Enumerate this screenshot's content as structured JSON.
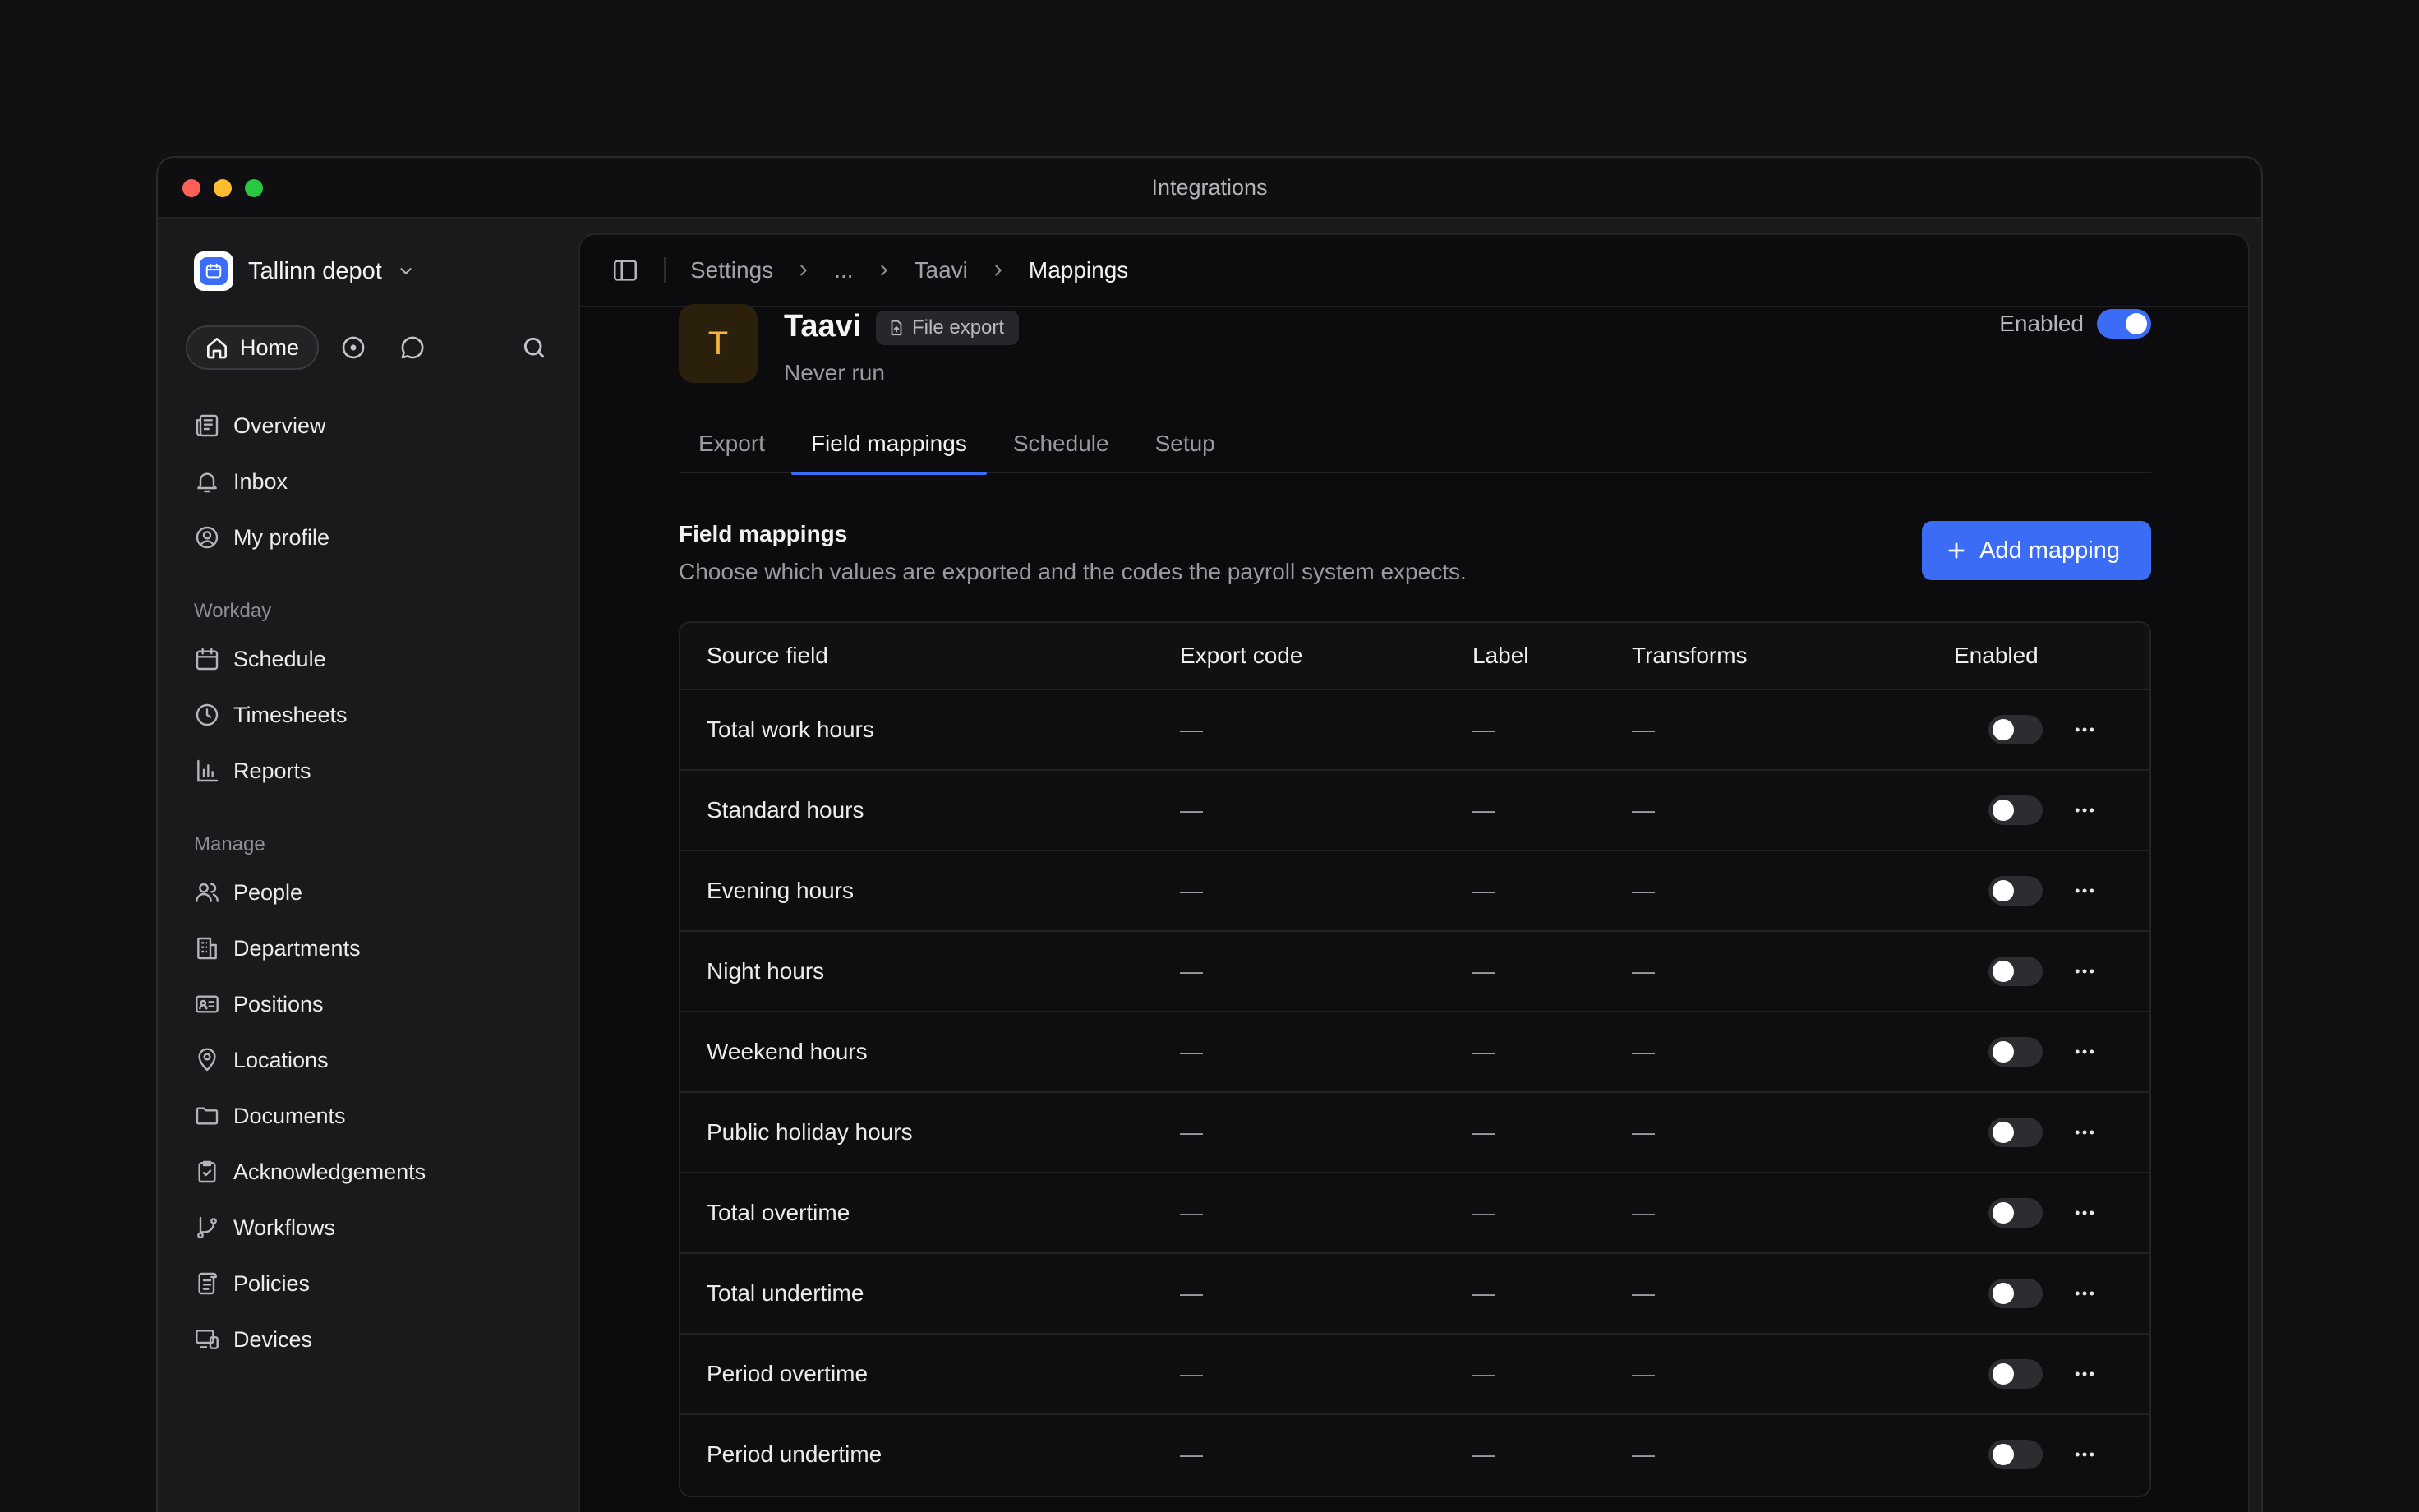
{
  "window": {
    "title": "Integrations"
  },
  "sidebar": {
    "workspace": "Tallinn depot",
    "home_label": "Home",
    "primary": [
      {
        "label": "Overview",
        "icon": "newspaper-icon"
      },
      {
        "label": "Inbox",
        "icon": "bell-icon"
      },
      {
        "label": "My profile",
        "icon": "user-circle-icon"
      }
    ],
    "sections": [
      {
        "title": "Workday",
        "items": [
          {
            "label": "Schedule",
            "icon": "calendar-icon"
          },
          {
            "label": "Timesheets",
            "icon": "clock-icon"
          },
          {
            "label": "Reports",
            "icon": "bar-chart-icon"
          }
        ]
      },
      {
        "title": "Manage",
        "items": [
          {
            "label": "People",
            "icon": "users-icon"
          },
          {
            "label": "Departments",
            "icon": "building-icon"
          },
          {
            "label": "Positions",
            "icon": "id-card-icon"
          },
          {
            "label": "Locations",
            "icon": "map-pin-icon"
          },
          {
            "label": "Documents",
            "icon": "folder-icon"
          },
          {
            "label": "Acknowledgements",
            "icon": "clipboard-check-icon"
          },
          {
            "label": "Workflows",
            "icon": "git-branch-icon"
          },
          {
            "label": "Policies",
            "icon": "scroll-icon"
          },
          {
            "label": "Devices",
            "icon": "devices-icon"
          }
        ]
      }
    ]
  },
  "breadcrumb": [
    "Settings",
    "...",
    "Taavi",
    "Mappings"
  ],
  "integration": {
    "avatar_letter": "T",
    "name": "Taavi",
    "badge": "File export",
    "status": "Never run",
    "enabled_label": "Enabled",
    "enabled": true
  },
  "tabs": [
    {
      "label": "Export",
      "active": false
    },
    {
      "label": "Field mappings",
      "active": true
    },
    {
      "label": "Schedule",
      "active": false
    },
    {
      "label": "Setup",
      "active": false
    }
  ],
  "section": {
    "title": "Field mappings",
    "subtitle": "Choose which values are exported and the codes the payroll system expects.",
    "add_button": "Add mapping"
  },
  "table": {
    "columns": [
      "Source field",
      "Export code",
      "Label",
      "Transforms",
      "Enabled"
    ],
    "rows": [
      {
        "source": "Total work hours",
        "code": "—",
        "label": "—",
        "transforms": "—",
        "enabled": false
      },
      {
        "source": "Standard hours",
        "code": "—",
        "label": "—",
        "transforms": "—",
        "enabled": false
      },
      {
        "source": "Evening hours",
        "code": "—",
        "label": "—",
        "transforms": "—",
        "enabled": false
      },
      {
        "source": "Night hours",
        "code": "—",
        "label": "—",
        "transforms": "—",
        "enabled": false
      },
      {
        "source": "Weekend hours",
        "code": "—",
        "label": "—",
        "transforms": "—",
        "enabled": false
      },
      {
        "source": "Public holiday hours",
        "code": "—",
        "label": "—",
        "transforms": "—",
        "enabled": false
      },
      {
        "source": "Total overtime",
        "code": "—",
        "label": "—",
        "transforms": "—",
        "enabled": false
      },
      {
        "source": "Total undertime",
        "code": "—",
        "label": "—",
        "transforms": "—",
        "enabled": false
      },
      {
        "source": "Period overtime",
        "code": "—",
        "label": "—",
        "transforms": "—",
        "enabled": false
      },
      {
        "source": "Period undertime",
        "code": "—",
        "label": "—",
        "transforms": "—",
        "enabled": false
      }
    ]
  }
}
